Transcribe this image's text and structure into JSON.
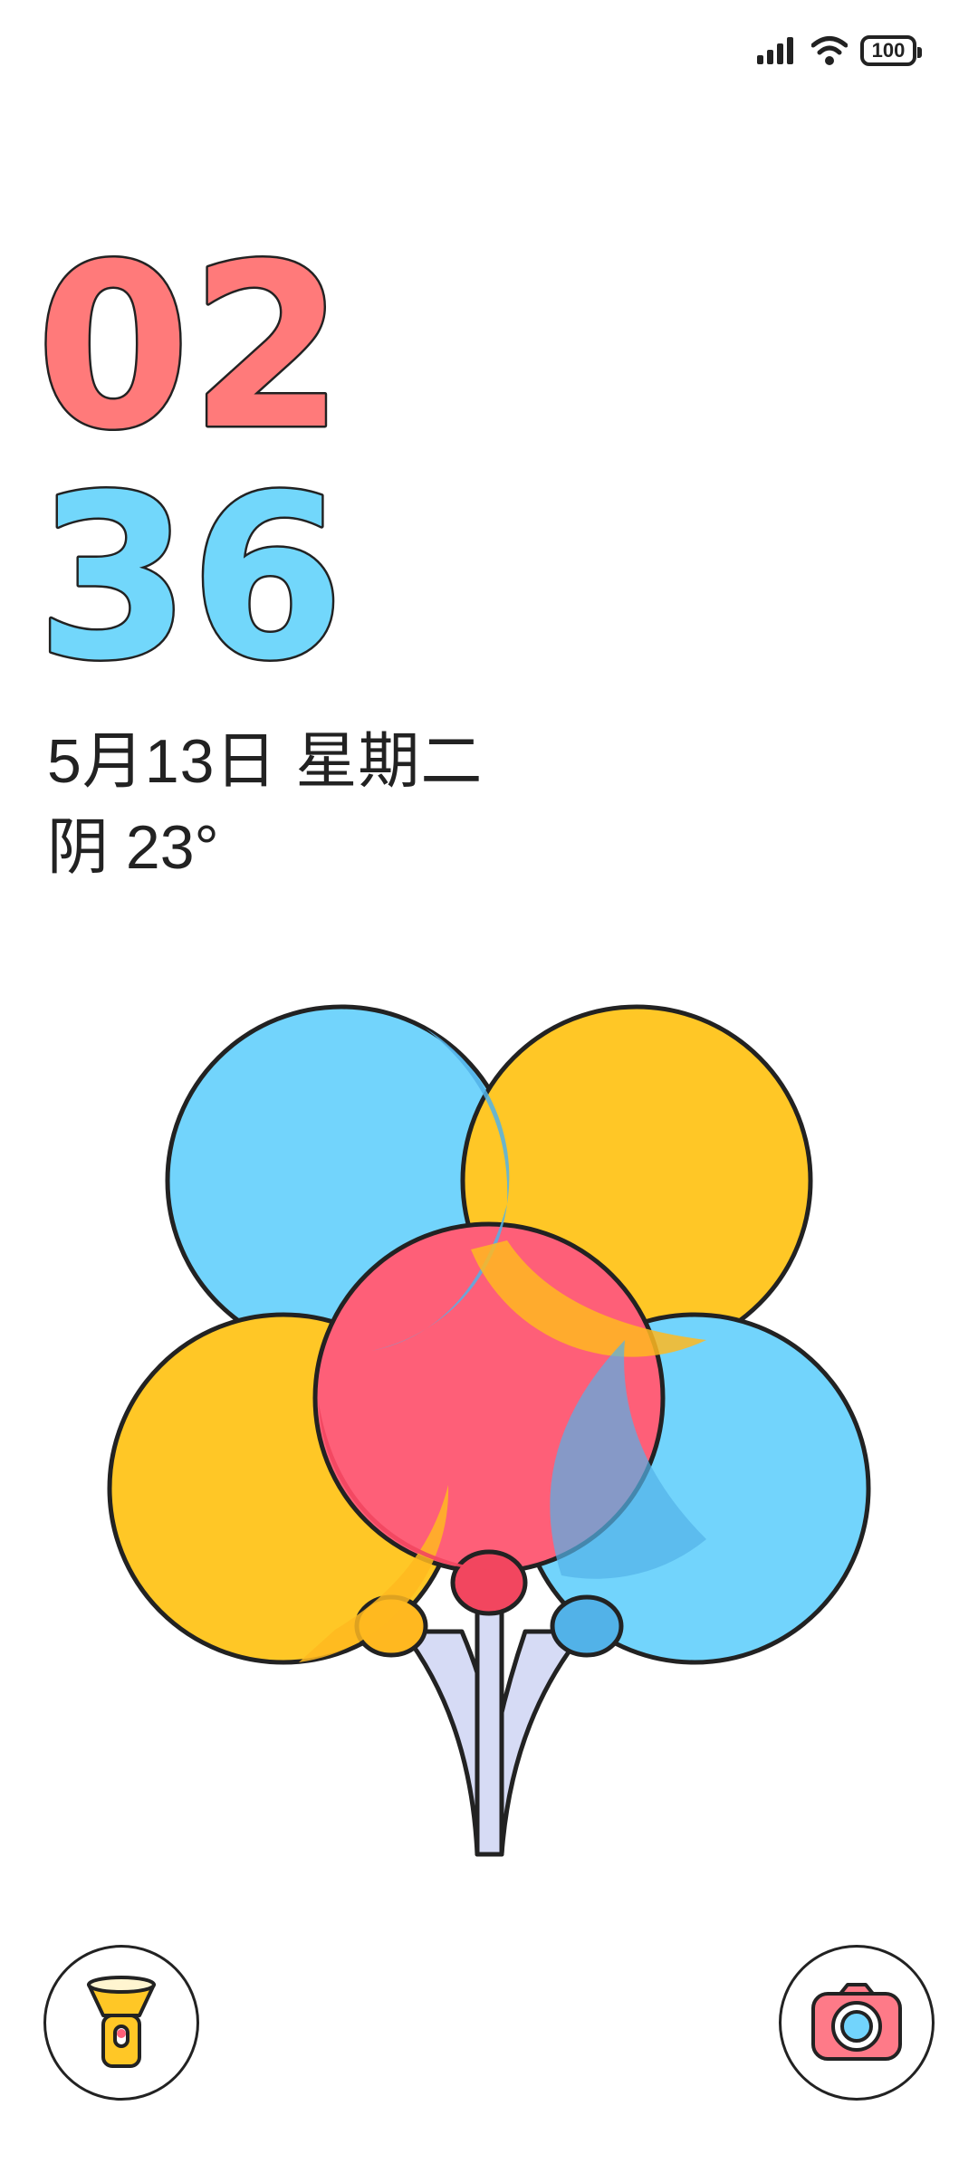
{
  "status_bar": {
    "battery_level": "100",
    "signal_icon": "cellular-signal-icon",
    "wifi_icon": "wifi-icon"
  },
  "clock": {
    "hours": "02",
    "minutes": "36",
    "hours_color": "#FF7A7A",
    "minutes_color": "#72D7FB"
  },
  "date_line": "5月13日 星期二",
  "weather_line": "阴 23°",
  "wallpaper": {
    "theme": "balloons",
    "colors": {
      "blue": "#72D4FC",
      "yellow": "#FFC726",
      "red": "#FE5F78",
      "string": "#D6DBF5"
    }
  },
  "shortcuts": {
    "left_icon": "flashlight-icon",
    "right_icon": "camera-icon"
  }
}
